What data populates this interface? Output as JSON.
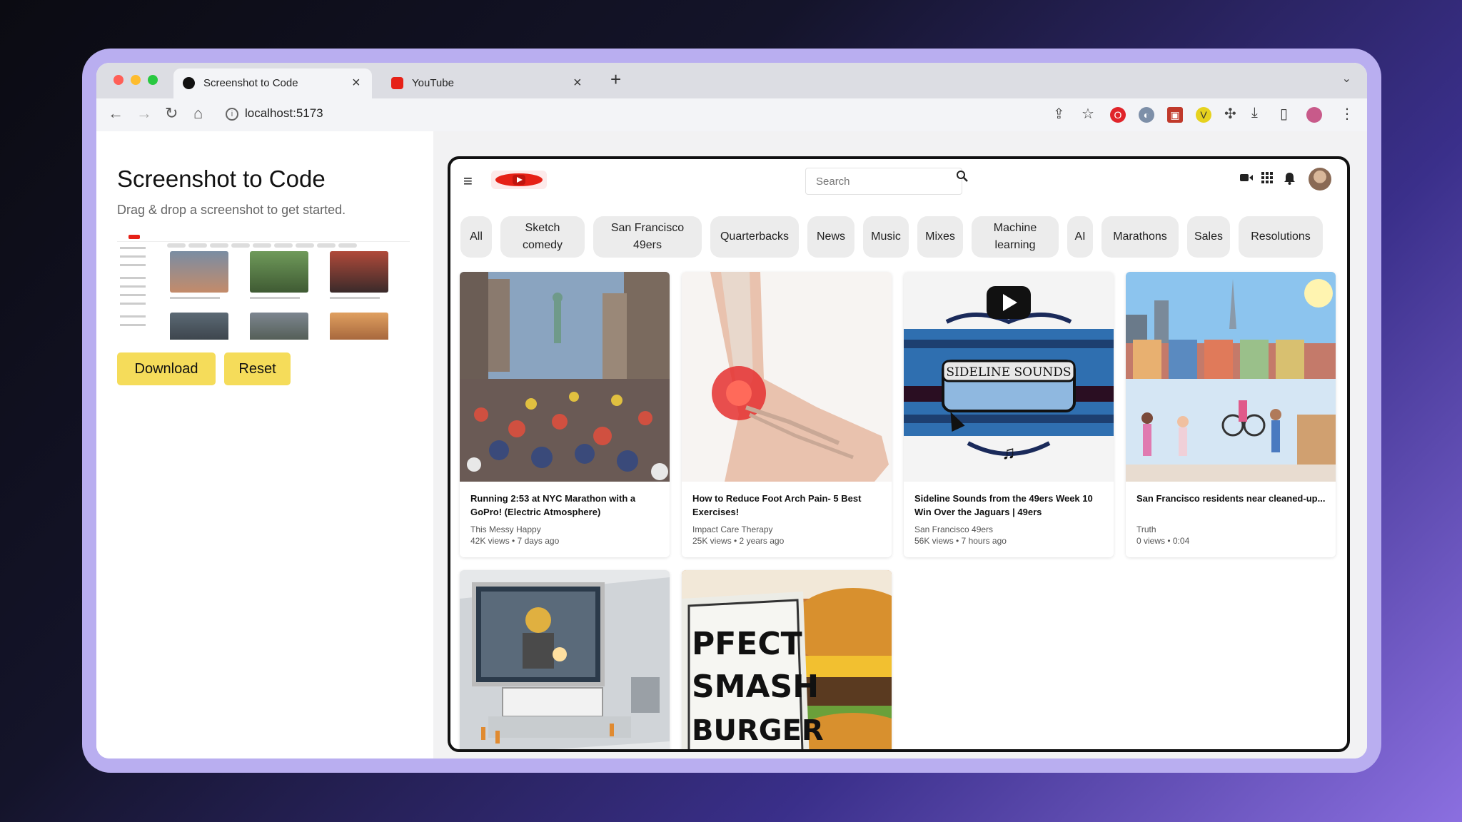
{
  "browser": {
    "tabs": [
      {
        "label": "Screenshot to Code"
      },
      {
        "label": "YouTube"
      }
    ],
    "url": "localhost:5173"
  },
  "left": {
    "title": "Screenshot to Code",
    "subtitle": "Drag & drop a screenshot to get started.",
    "download_label": "Download",
    "reset_label": "Reset"
  },
  "preview": {
    "search_placeholder": "Search",
    "chips": [
      {
        "line1": "All",
        "line2": ""
      },
      {
        "line1": "Sketch",
        "line2": "comedy"
      },
      {
        "line1": "San Francisco",
        "line2": "49ers"
      },
      {
        "line1": "Quarterbacks",
        "line2": ""
      },
      {
        "line1": "News",
        "line2": ""
      },
      {
        "line1": "Music",
        "line2": ""
      },
      {
        "line1": "Mixes",
        "line2": ""
      },
      {
        "line1": "Machine",
        "line2": "learning"
      },
      {
        "line1": "AI",
        "line2": ""
      },
      {
        "line1": "Marathons",
        "line2": ""
      },
      {
        "line1": "Sales",
        "line2": ""
      },
      {
        "line1": "Resolutions",
        "line2": ""
      }
    ],
    "videos": [
      {
        "title": "Running 2:53 at NYC Marathon with a GoPro! (Electric Atmosphere)",
        "channel": "This Messy Happy",
        "stats": "42K views • 7 days ago"
      },
      {
        "title": "How to Reduce Foot Arch Pain- 5 Best Exercises!",
        "channel": "Impact Care Therapy",
        "stats": "25K views • 2 years ago"
      },
      {
        "title": "Sideline Sounds from the 49ers Week 10 Win Over the Jaguars | 49ers",
        "channel": "San Francisco 49ers",
        "stats": "56K views • 7 hours ago"
      },
      {
        "title": "San Francisco residents near cleaned-up...",
        "channel": "Truth",
        "stats": "0 views • 0:04"
      },
      {
        "title": "",
        "channel": "",
        "stats": ""
      },
      {
        "title": "",
        "channel": "",
        "stats": ""
      }
    ],
    "thumb_text": {
      "sideline": "SIDELINE SOUNDS",
      "burger": [
        "PFECT",
        "SMASH",
        "BURGER"
      ]
    }
  },
  "colors": {
    "accent_yellow": "#f5dc5a",
    "youtube_red": "#e62117",
    "mac_red": "#ff5f57",
    "mac_yellow": "#febc2e",
    "mac_green": "#28c840"
  }
}
